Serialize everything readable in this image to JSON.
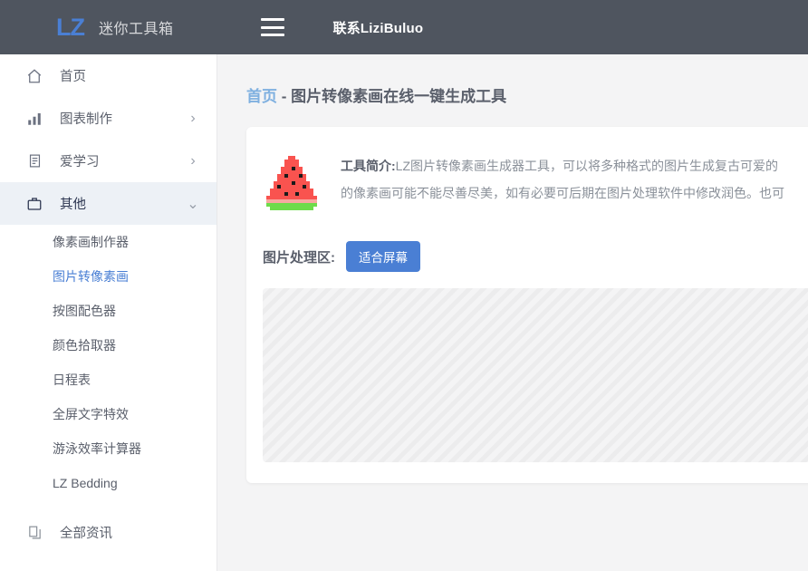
{
  "header": {
    "logo": "LZ",
    "site_title": "迷你工具箱",
    "menu_icon": "hamburger-icon",
    "contact_label": "联系LiziBuluo"
  },
  "sidebar": {
    "items": [
      {
        "label": "首页",
        "icon": "home-icon",
        "arrow": "",
        "active": false
      },
      {
        "label": "图表制作",
        "icon": "bar-chart-icon",
        "arrow": "›",
        "active": false
      },
      {
        "label": "爱学习",
        "icon": "document-icon",
        "arrow": "›",
        "active": false
      },
      {
        "label": "其他",
        "icon": "briefcase-icon",
        "arrow": "⌄",
        "active": true
      }
    ],
    "sub_items": [
      {
        "label": "像素画制作器",
        "active": false
      },
      {
        "label": "图片转像素画",
        "active": true
      },
      {
        "label": "按图配色器",
        "active": false
      },
      {
        "label": "颜色拾取器",
        "active": false
      },
      {
        "label": "日程表",
        "active": false
      },
      {
        "label": "全屏文字特效",
        "active": false
      },
      {
        "label": "游泳效率计算器",
        "active": false
      },
      {
        "label": "LZ Bedding",
        "active": false
      }
    ],
    "footer_item": {
      "label": "全部资讯",
      "icon": "copy-icon"
    }
  },
  "main": {
    "breadcrumb": "首页",
    "title_separator": " - ",
    "page_title": "图片转像素画在线一键生成工具",
    "intro_icon": "watermelon-pixel-icon",
    "intro_label": "工具简介:",
    "intro_line1": "LZ图片转像素画生成器工具，可以将多种格式的图片生成复古可爱的",
    "intro_line2": "的像素画可能不能尽善尽美，如有必要可后期在图片处理软件中修改润色。也可",
    "processing_label": "图片处理区:",
    "fit_button": "适合屏幕"
  },
  "colors": {
    "header_bg": "#4f555f",
    "accent_blue": "#4a7fd4",
    "page_bg": "#f4f4f5",
    "sidebar_bg": "#ffffff",
    "active_nav_bg": "#edf1f6",
    "text_muted": "#8a9099",
    "breadcrumb_blue": "#7fb0e0"
  }
}
